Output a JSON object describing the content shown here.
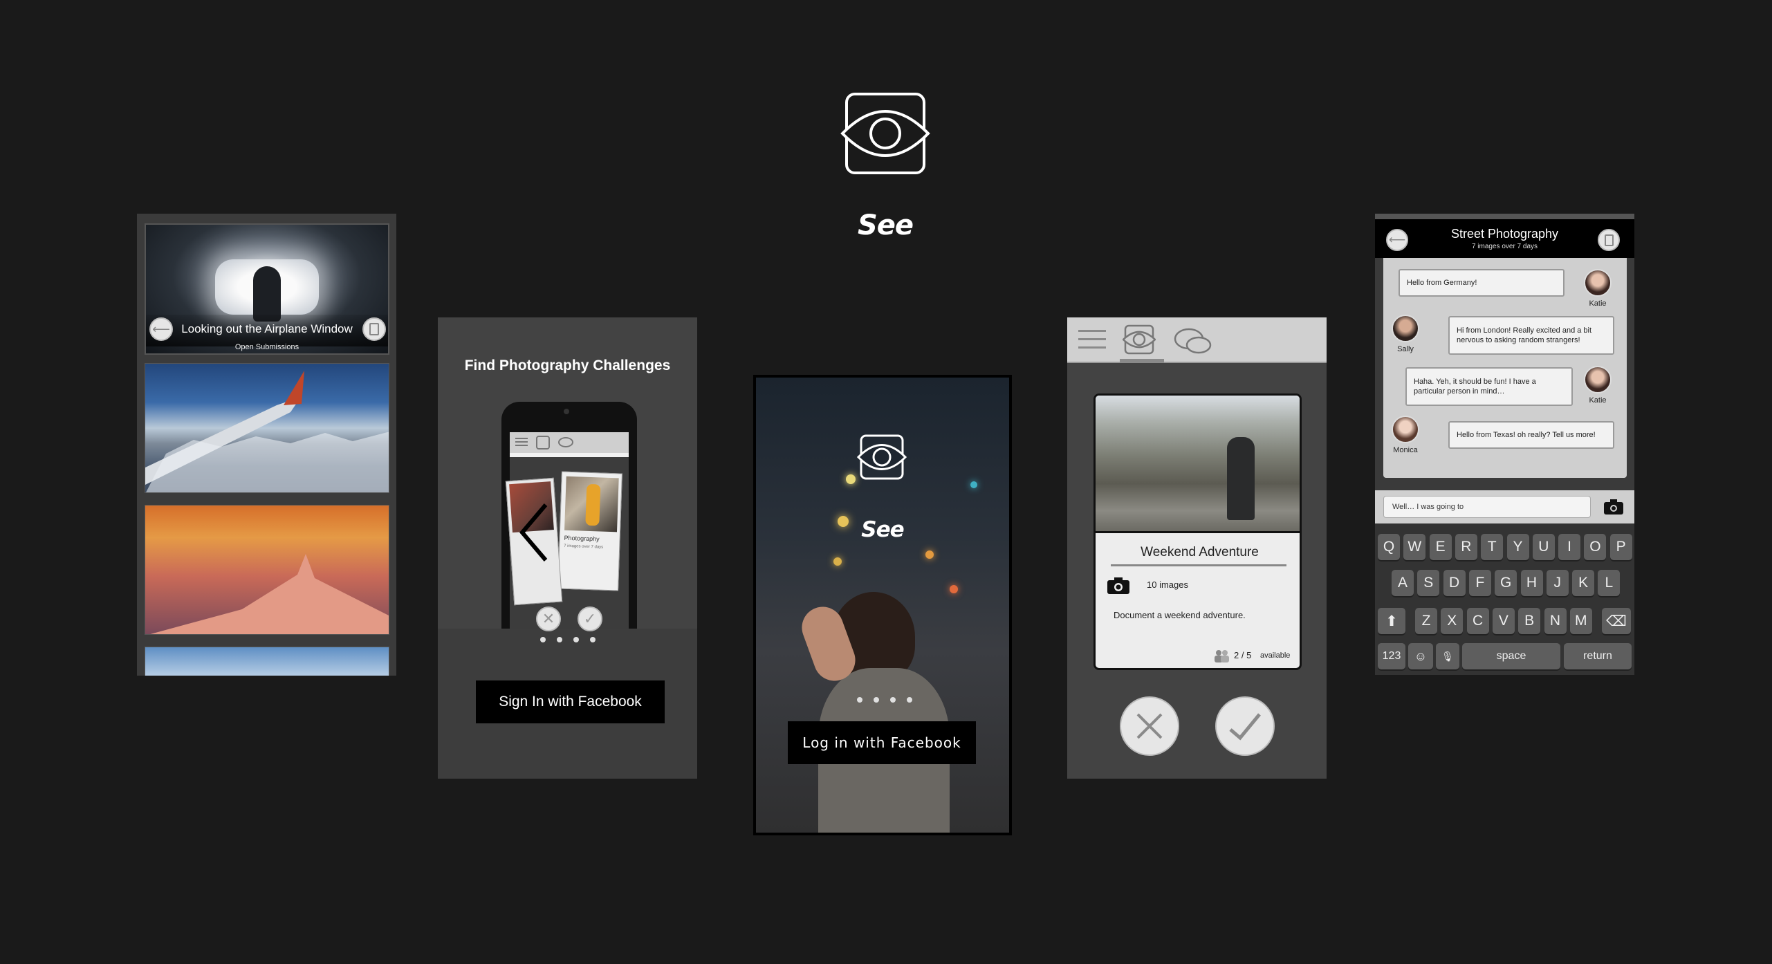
{
  "app": {
    "name": "See"
  },
  "screen1": {
    "hero_title": "Looking out the Airplane Window",
    "hero_subtitle": "Open Submissions"
  },
  "screen2": {
    "heading": "Find Photography Challenges",
    "button_label": "Sign In  with Facebook",
    "mini_card": {
      "title": "Photography",
      "meta": "7 images over 7 days"
    }
  },
  "screen3": {
    "logo_text": "See",
    "button_label": "Log in with Facebook"
  },
  "screen4": {
    "card_title": "Weekend Adventure",
    "images_count": "10 images",
    "description": "Document a weekend adventure.",
    "availability": "2 / 5",
    "availability_label": "available"
  },
  "screen5": {
    "title": "Street Photography",
    "subtitle": "7 images over 7 days",
    "messages": [
      {
        "side": "left",
        "text": "Hello from Germany!",
        "name": "Katie"
      },
      {
        "side": "right",
        "text": "Hi from London! Really excited and a bit nervous to asking random strangers!",
        "name": "Sally"
      },
      {
        "side": "left",
        "text": "Haha. Yeh, it should be fun! I have a particular person in mind…",
        "name": "Katie"
      },
      {
        "side": "right",
        "text": "Hello from Texas! oh really? Tell us more!",
        "name": "Monica"
      }
    ],
    "input_value": "Well… I was going to",
    "keyboard": {
      "row1": [
        "Q",
        "W",
        "E",
        "R",
        "T",
        "Y",
        "U",
        "I",
        "O",
        "P"
      ],
      "row2": [
        "A",
        "S",
        "D",
        "F",
        "G",
        "H",
        "J",
        "K",
        "L"
      ],
      "row3": [
        "Z",
        "X",
        "C",
        "V",
        "B",
        "N",
        "M"
      ],
      "numbers_key": "123",
      "space_key": "space",
      "return_key": "return"
    }
  },
  "colors": {
    "background": "#1a1a1a",
    "panel": "#434343",
    "button": "#000000"
  }
}
